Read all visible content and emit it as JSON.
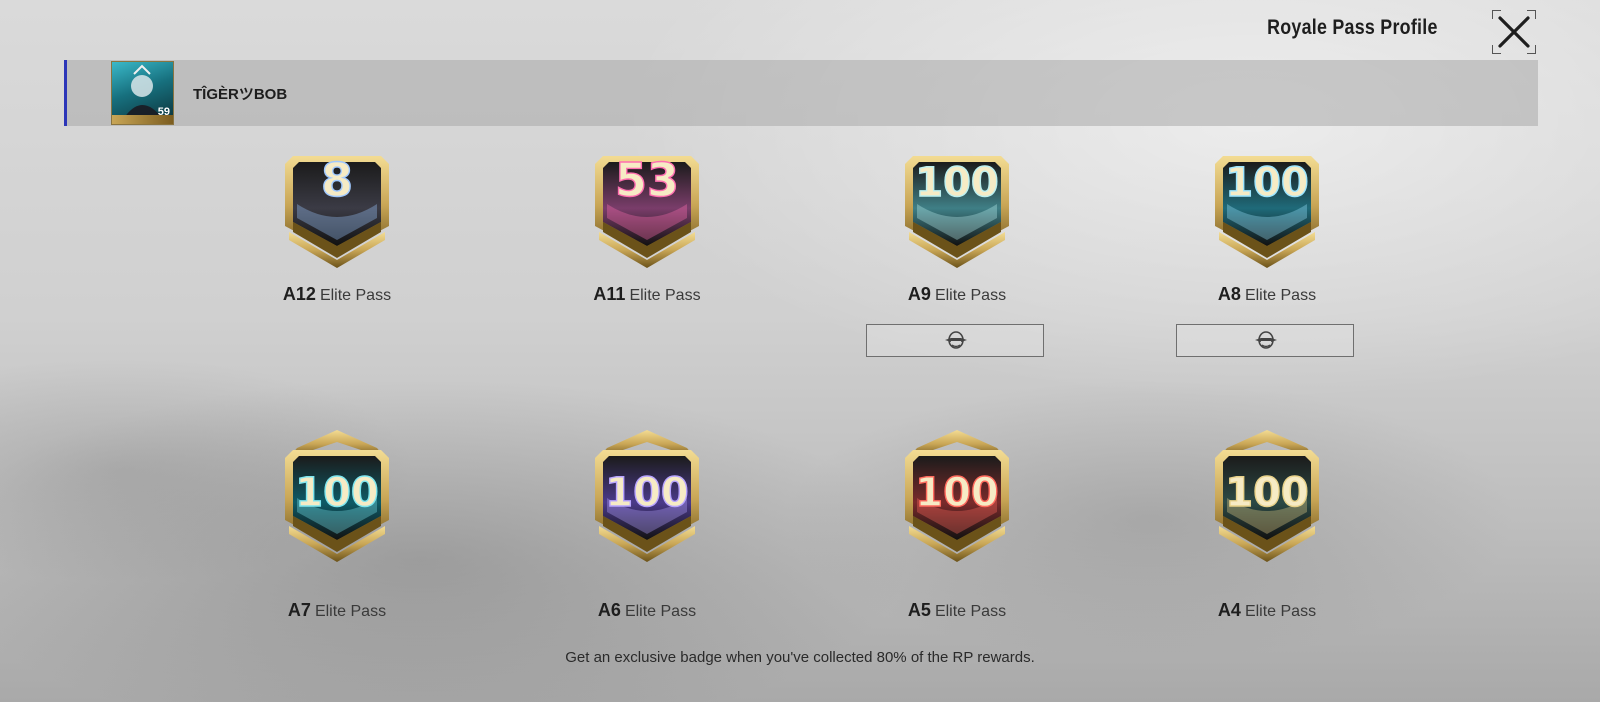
{
  "header": {
    "title": "Royale Pass Profile",
    "close_icon": "close-icon"
  },
  "profile": {
    "player_name": "TÎGÈRツBOB",
    "avatar_level": "59"
  },
  "badges": [
    {
      "number": "8",
      "season": "A12",
      "tier": "Elite Pass",
      "theme": "#3b3b45",
      "accent": "#9fc8ff"
    },
    {
      "number": "53",
      "season": "A11",
      "tier": "Elite Pass",
      "theme": "#7a3d6a",
      "accent": "#ff6fb1"
    },
    {
      "number": "100",
      "season": "A9",
      "tier": "Elite Pass",
      "theme": "#3f7f86",
      "accent": "#bdf0f0"
    },
    {
      "number": "100",
      "season": "A8",
      "tier": "Elite Pass",
      "theme": "#1f6a79",
      "accent": "#9ee6ff"
    },
    {
      "number": "100",
      "season": "A7",
      "tier": "Elite Pass",
      "theme": "#0e5a66",
      "accent": "#7fe6ef"
    },
    {
      "number": "100",
      "season": "A6",
      "tier": "Elite Pass",
      "theme": "#4b3a8a",
      "accent": "#b8a5ff"
    },
    {
      "number": "100",
      "season": "A5",
      "tier": "Elite Pass",
      "theme": "#7a2b2b",
      "accent": "#ff6b5e"
    },
    {
      "number": "100",
      "season": "A4",
      "tier": "Elite Pass",
      "theme": "#2c4a45",
      "accent": "#e8d28a"
    }
  ],
  "emblem_buttons": [
    {
      "for_season": "A9",
      "icon": "helmet-wings-icon"
    },
    {
      "for_season": "A8",
      "icon": "helmet-wings-icon"
    }
  ],
  "footer": {
    "note": "Get an exclusive badge when you've collected 80% of the RP rewards."
  },
  "colors": {
    "gold": "#c9a656",
    "gold_dark": "#6b5219",
    "accent_bar": "#2c36b8"
  }
}
